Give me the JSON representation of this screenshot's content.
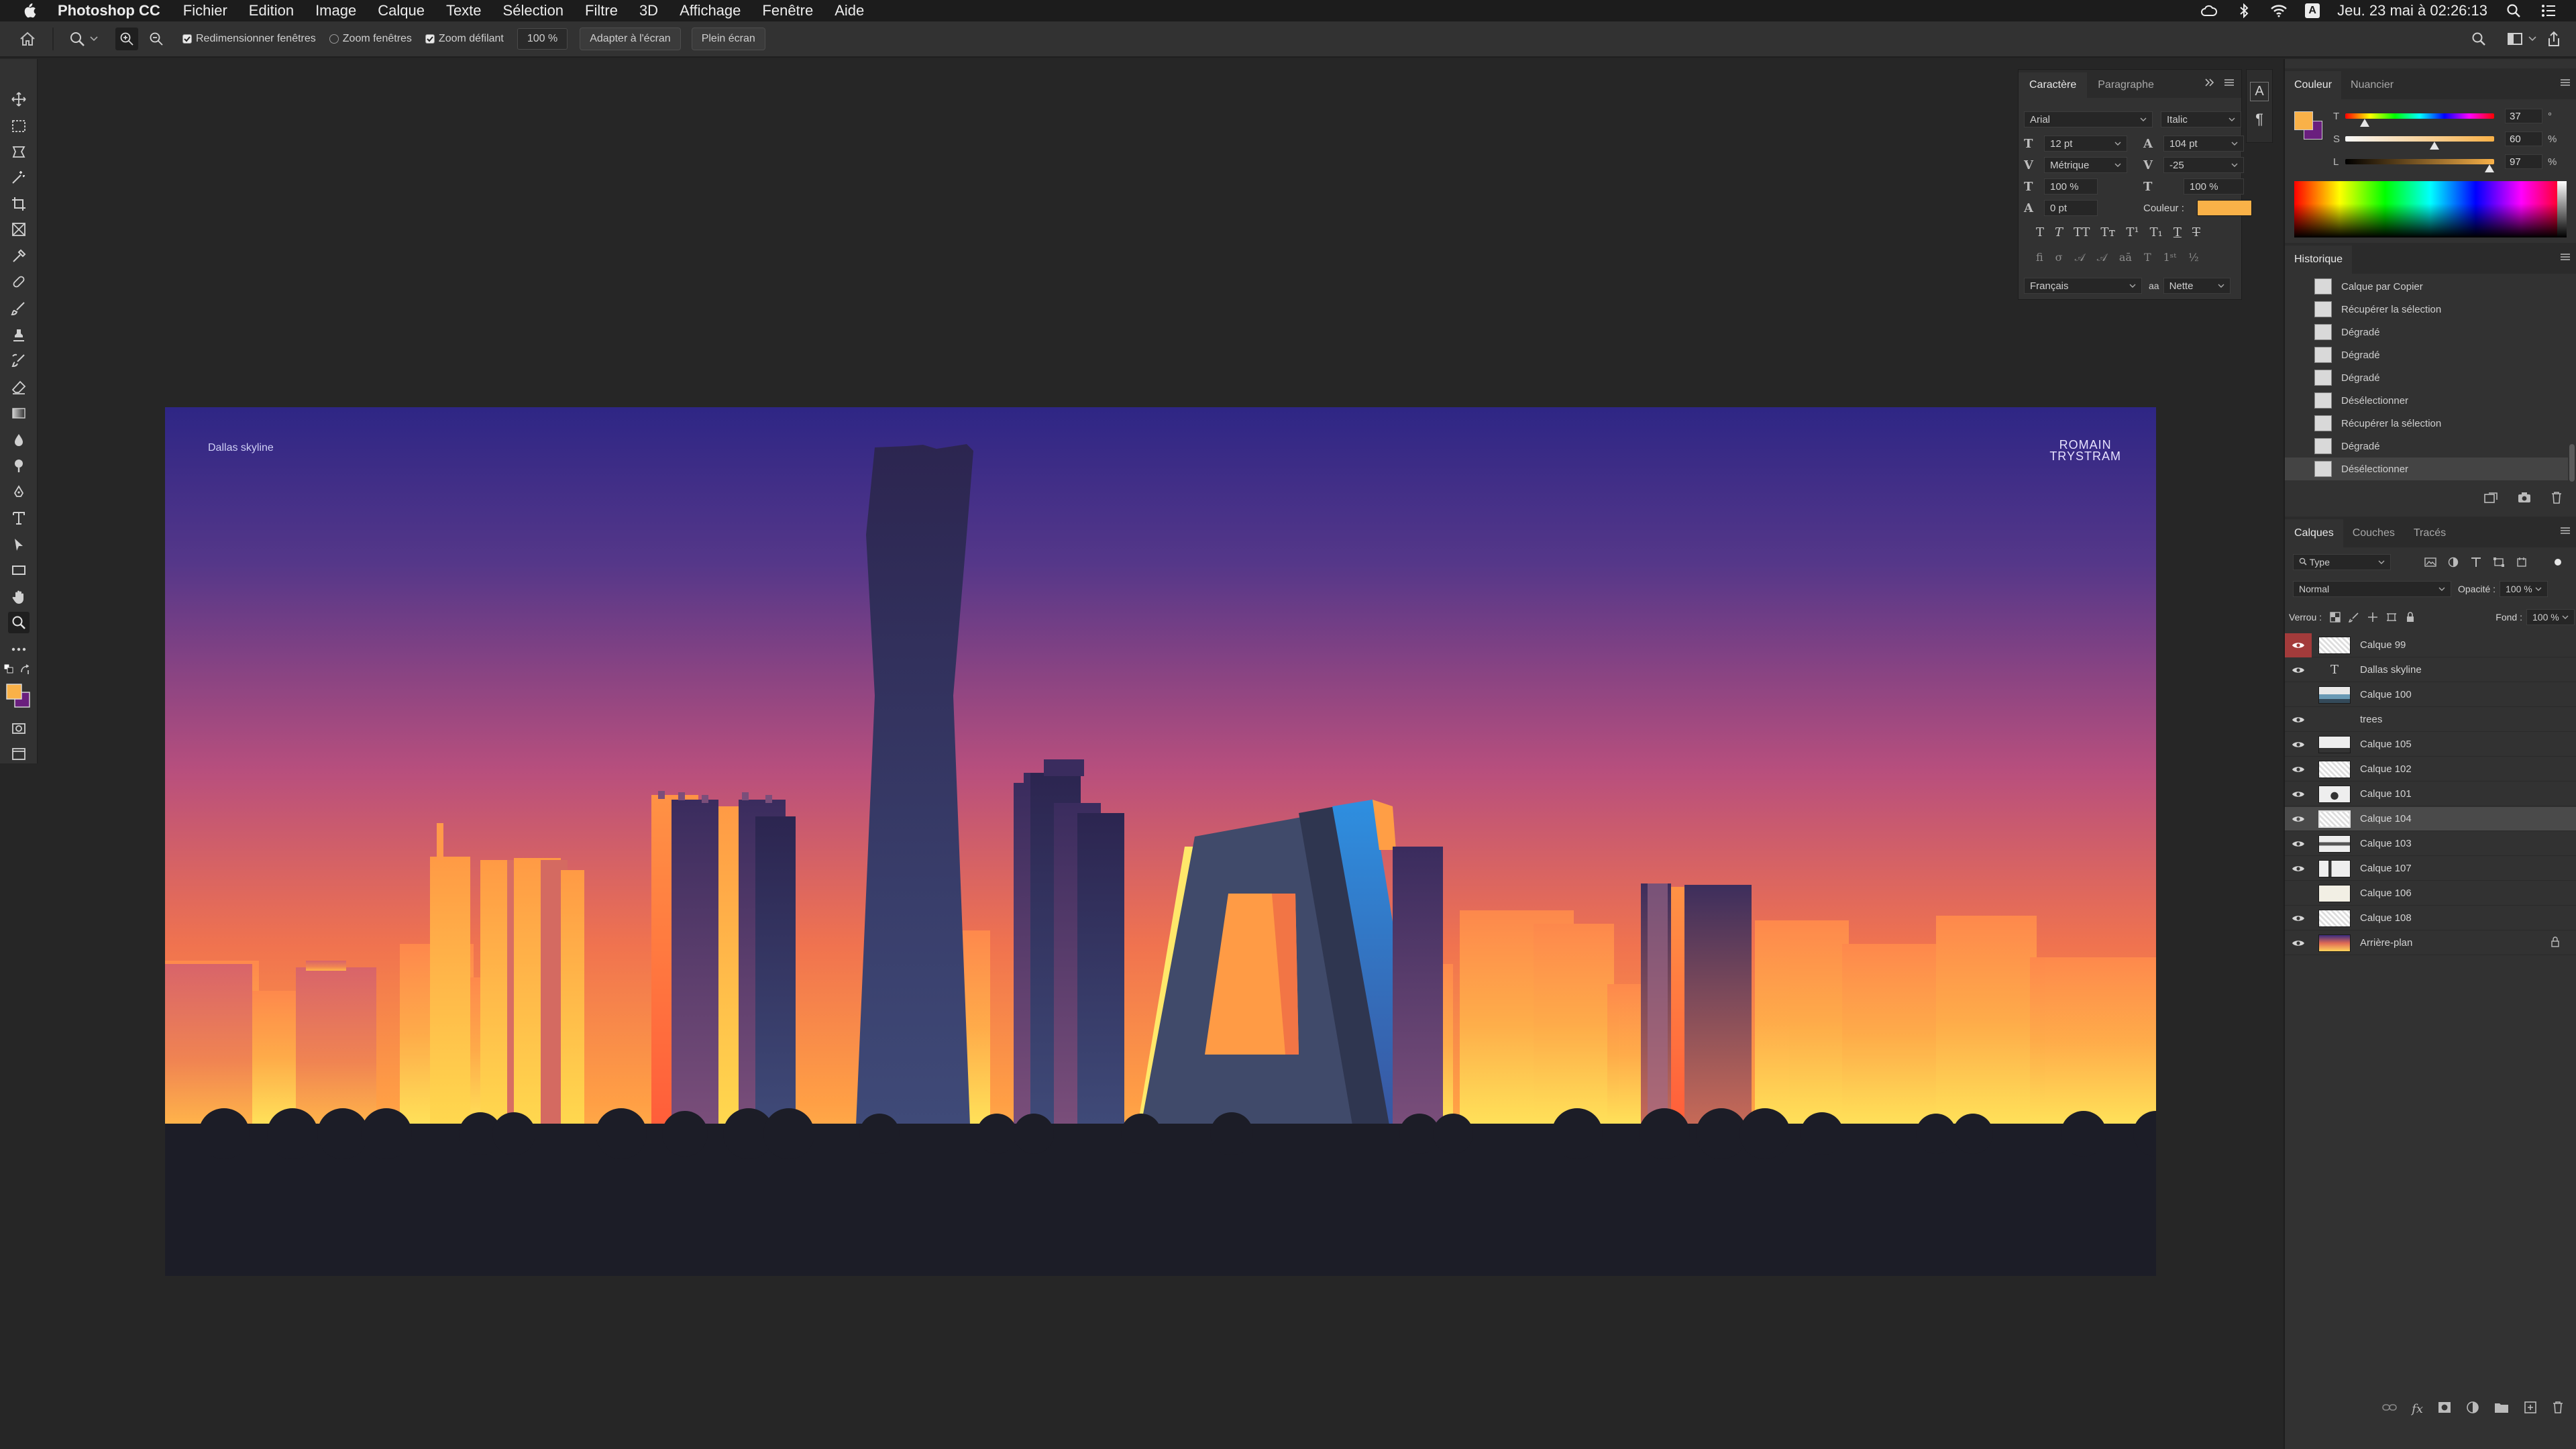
{
  "menubar": {
    "app_name": "Photoshop CC",
    "items": [
      "Fichier",
      "Edition",
      "Image",
      "Calque",
      "Texte",
      "Sélection",
      "Filtre",
      "3D",
      "Affichage",
      "Fenêtre",
      "Aide"
    ],
    "clock": "Jeu. 23 mai à 02:26:13",
    "input_source": "A"
  },
  "options_bar": {
    "resize_windows": "Redimensionner fenêtres",
    "zoom_windows": "Zoom fenêtres",
    "scrubby_zoom": "Zoom défilant",
    "zoom_value": "100 %",
    "fit_screen": "Adapter à l'écran",
    "fill_screen": "Plein écran"
  },
  "canvas": {
    "label": "Dallas skyline",
    "brand_line1": "ROMAIN",
    "brand_line2": "TRYSTRAM"
  },
  "character_panel": {
    "tabs": [
      "Caractère",
      "Paragraphe"
    ],
    "font_family": "Arial",
    "font_style": "Italic",
    "font_size": "12 pt",
    "leading": "104 pt",
    "kerning": "Métrique",
    "tracking": "-25",
    "vertical_scale": "100 %",
    "horizontal_scale": "100 %",
    "baseline_shift": "0 pt",
    "color_label": "Couleur :",
    "language": "Français",
    "antialias": "Nette"
  },
  "color_panel": {
    "tabs": [
      "Couleur",
      "Nuancier"
    ],
    "foreground": "#f9b148",
    "background": "#6a1f7e",
    "sliders": [
      {
        "label": "T",
        "value": "37",
        "unit": "°"
      },
      {
        "label": "S",
        "value": "60",
        "unit": "%"
      },
      {
        "label": "L",
        "value": "97",
        "unit": "%"
      }
    ]
  },
  "history_panel": {
    "title": "Historique",
    "items": [
      "Calque par Copier",
      "Récupérer la sélection",
      "Dégradé",
      "Dégradé",
      "Dégradé",
      "Désélectionner",
      "Récupérer la sélection",
      "Dégradé",
      "Désélectionner"
    ],
    "selected_index": 8
  },
  "layers_panel": {
    "tabs": [
      "Calques",
      "Couches",
      "Tracés"
    ],
    "filter": "Type",
    "blend_mode": "Normal",
    "opacity_label": "Opacité :",
    "opacity": "100 %",
    "lock_label": "Verrou :",
    "fill_label": "Fond :",
    "fill": "100 %",
    "layers": [
      {
        "name": "Calque 99",
        "visible": true
      },
      {
        "name": "Dallas skyline",
        "visible": true
      },
      {
        "name": "Calque 100",
        "visible": false
      },
      {
        "name": "trees",
        "visible": true
      },
      {
        "name": "Calque 105",
        "visible": true
      },
      {
        "name": "Calque 102",
        "visible": true
      },
      {
        "name": "Calque 101",
        "visible": true
      },
      {
        "name": "Calque 104",
        "visible": true
      },
      {
        "name": "Calque 103",
        "visible": true
      },
      {
        "name": "Calque 107",
        "visible": true
      },
      {
        "name": "Calque 106",
        "visible": true
      },
      {
        "name": "Calque 108",
        "visible": true
      },
      {
        "name": "Arrière-plan",
        "visible": true
      }
    ],
    "selected_layer": "Calque 104"
  }
}
